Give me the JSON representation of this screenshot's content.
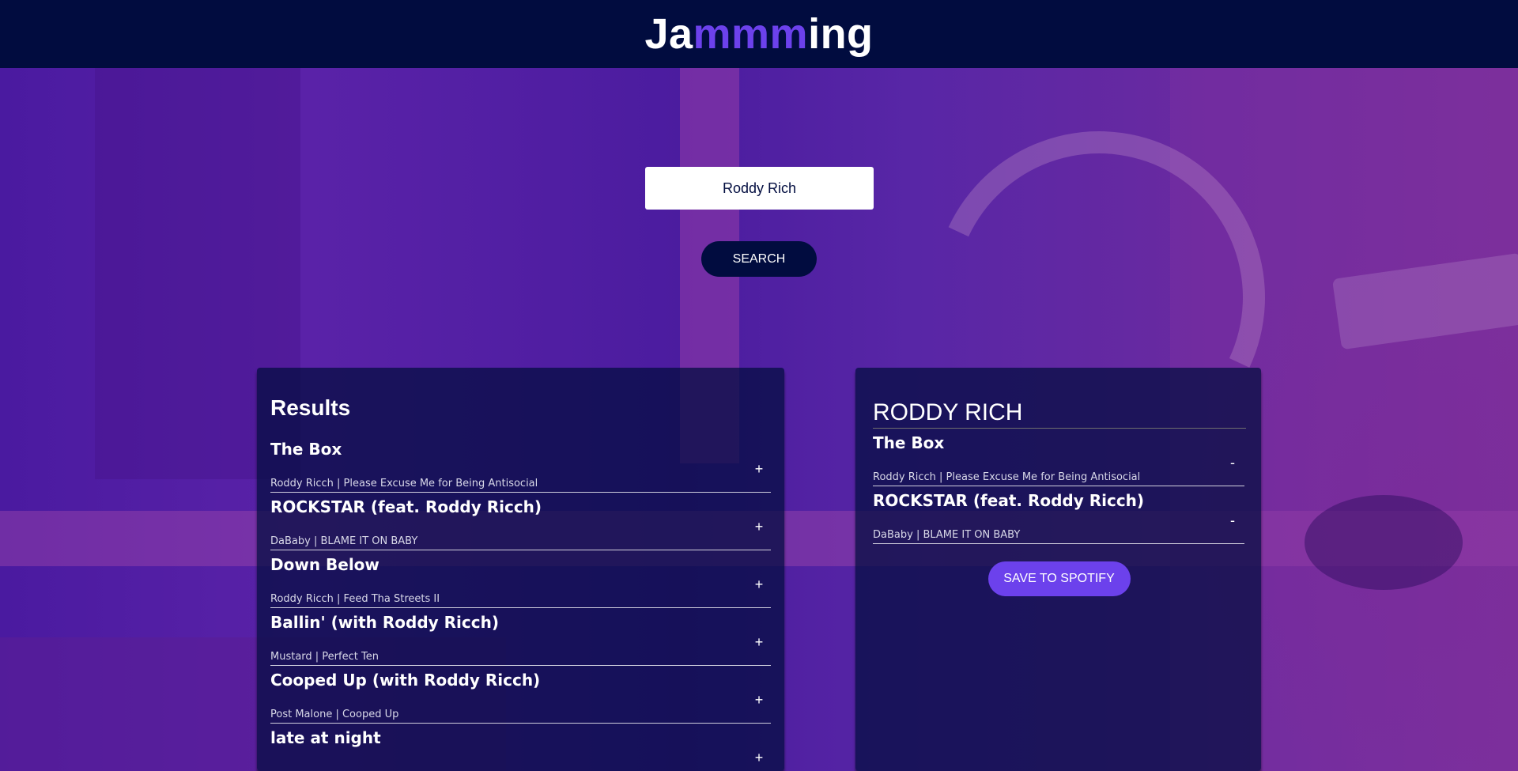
{
  "header": {
    "title_prefix": "Ja",
    "title_highlight": "mmm",
    "title_suffix": "ing"
  },
  "search": {
    "value": "Roddy Rich",
    "button_label": "SEARCH"
  },
  "results": {
    "heading": "Results",
    "tracks": [
      {
        "name": "The Box",
        "meta": "Roddy Ricch | Please Excuse Me for Being Antisocial",
        "action": "+"
      },
      {
        "name": "ROCKSTAR (feat. Roddy Ricch)",
        "meta": "DaBaby | BLAME IT ON BABY",
        "action": "+"
      },
      {
        "name": "Down Below",
        "meta": "Roddy Ricch | Feed Tha Streets II",
        "action": "+"
      },
      {
        "name": "Ballin' (with Roddy Ricch)",
        "meta": "Mustard | Perfect Ten",
        "action": "+"
      },
      {
        "name": "Cooped Up (with Roddy Ricch)",
        "meta": "Post Malone | Cooped Up",
        "action": "+"
      },
      {
        "name": "late at night",
        "meta": "",
        "action": "+"
      }
    ]
  },
  "playlist": {
    "name": "RODDY RICH",
    "tracks": [
      {
        "name": "The Box",
        "meta": "Roddy Ricch | Please Excuse Me for Being Antisocial",
        "action": "-"
      },
      {
        "name": "ROCKSTAR (feat. Roddy Ricch)",
        "meta": "DaBaby | BLAME IT ON BABY",
        "action": "-"
      }
    ],
    "save_label": "SAVE TO SPOTIFY"
  },
  "colors": {
    "header_bg": "#010c3f",
    "accent": "#6c41ec",
    "text": "#ffffff"
  }
}
